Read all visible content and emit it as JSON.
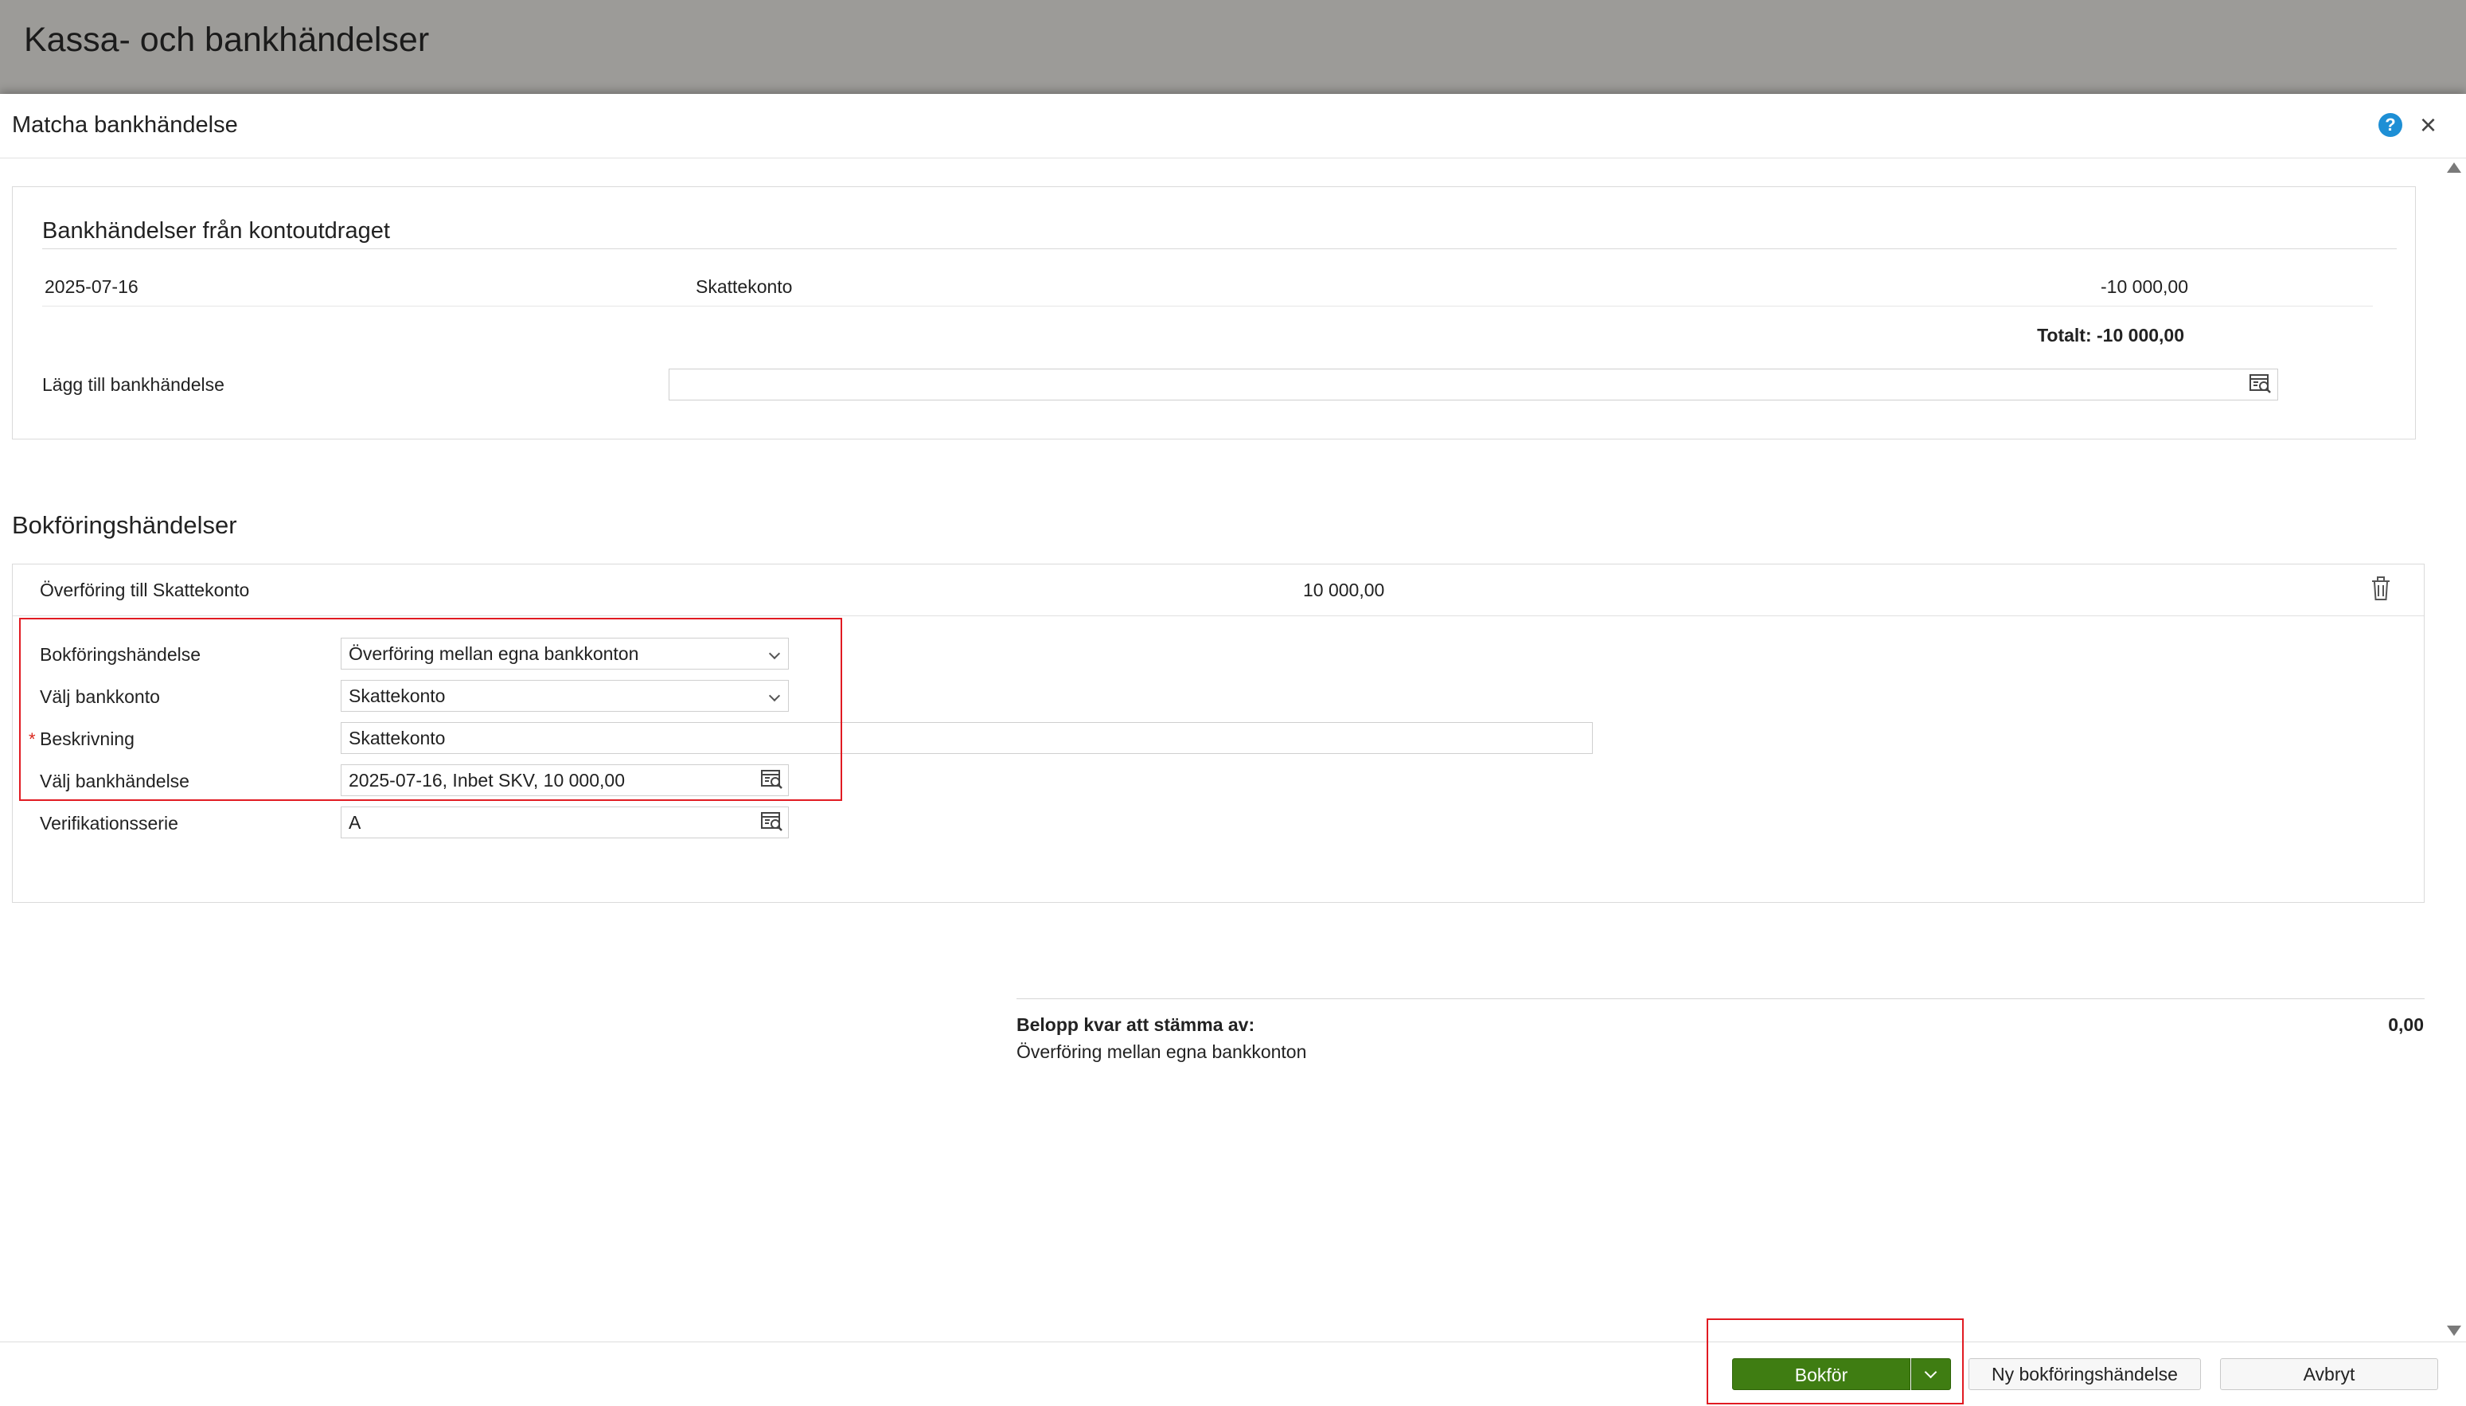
{
  "app": {
    "title": "Kassa- och bankhändelser"
  },
  "dialog": {
    "title": "Matcha bankhändelse",
    "help_label": "?",
    "close_label": "×"
  },
  "bank_events": {
    "heading": "Bankhändelser från kontoutdraget",
    "rows": [
      {
        "date": "2025-07-16",
        "description": "Skattekonto",
        "amount": "-10 000,00"
      }
    ],
    "total": "Totalt: -10 000,00",
    "add_label": "Lägg till bankhändelse",
    "add_value": ""
  },
  "booking": {
    "heading": "Bokföringshändelser",
    "item": {
      "title": "Överföring till Skattekonto",
      "amount": "10 000,00"
    },
    "fields": {
      "event_label": "Bokföringshändelse",
      "event_value": "Överföring mellan egna bankkonton",
      "account_label": "Välj bankkonto",
      "account_value": "Skattekonto",
      "description_required": "*",
      "description_label": "Beskrivning",
      "description_value": "Skattekonto",
      "bank_event_label": "Välj bankhändelse",
      "bank_event_value": "2025-07-16, Inbet SKV, 10 000,00",
      "series_label": "Verifikationsserie",
      "series_value": "A"
    }
  },
  "summary": {
    "label": "Belopp kvar att stämma av:",
    "value": "0,00",
    "sub": "Överföring mellan egna bankkonton"
  },
  "footer": {
    "post_label": "Bokför",
    "new_event_label": "Ny bokföringshändelse",
    "cancel_label": "Avbryt"
  },
  "colors": {
    "primary_button": "#3f7d12",
    "highlight": "#e11b22",
    "help_icon": "#1e8fd5",
    "top_bar": "#9c9b98"
  }
}
